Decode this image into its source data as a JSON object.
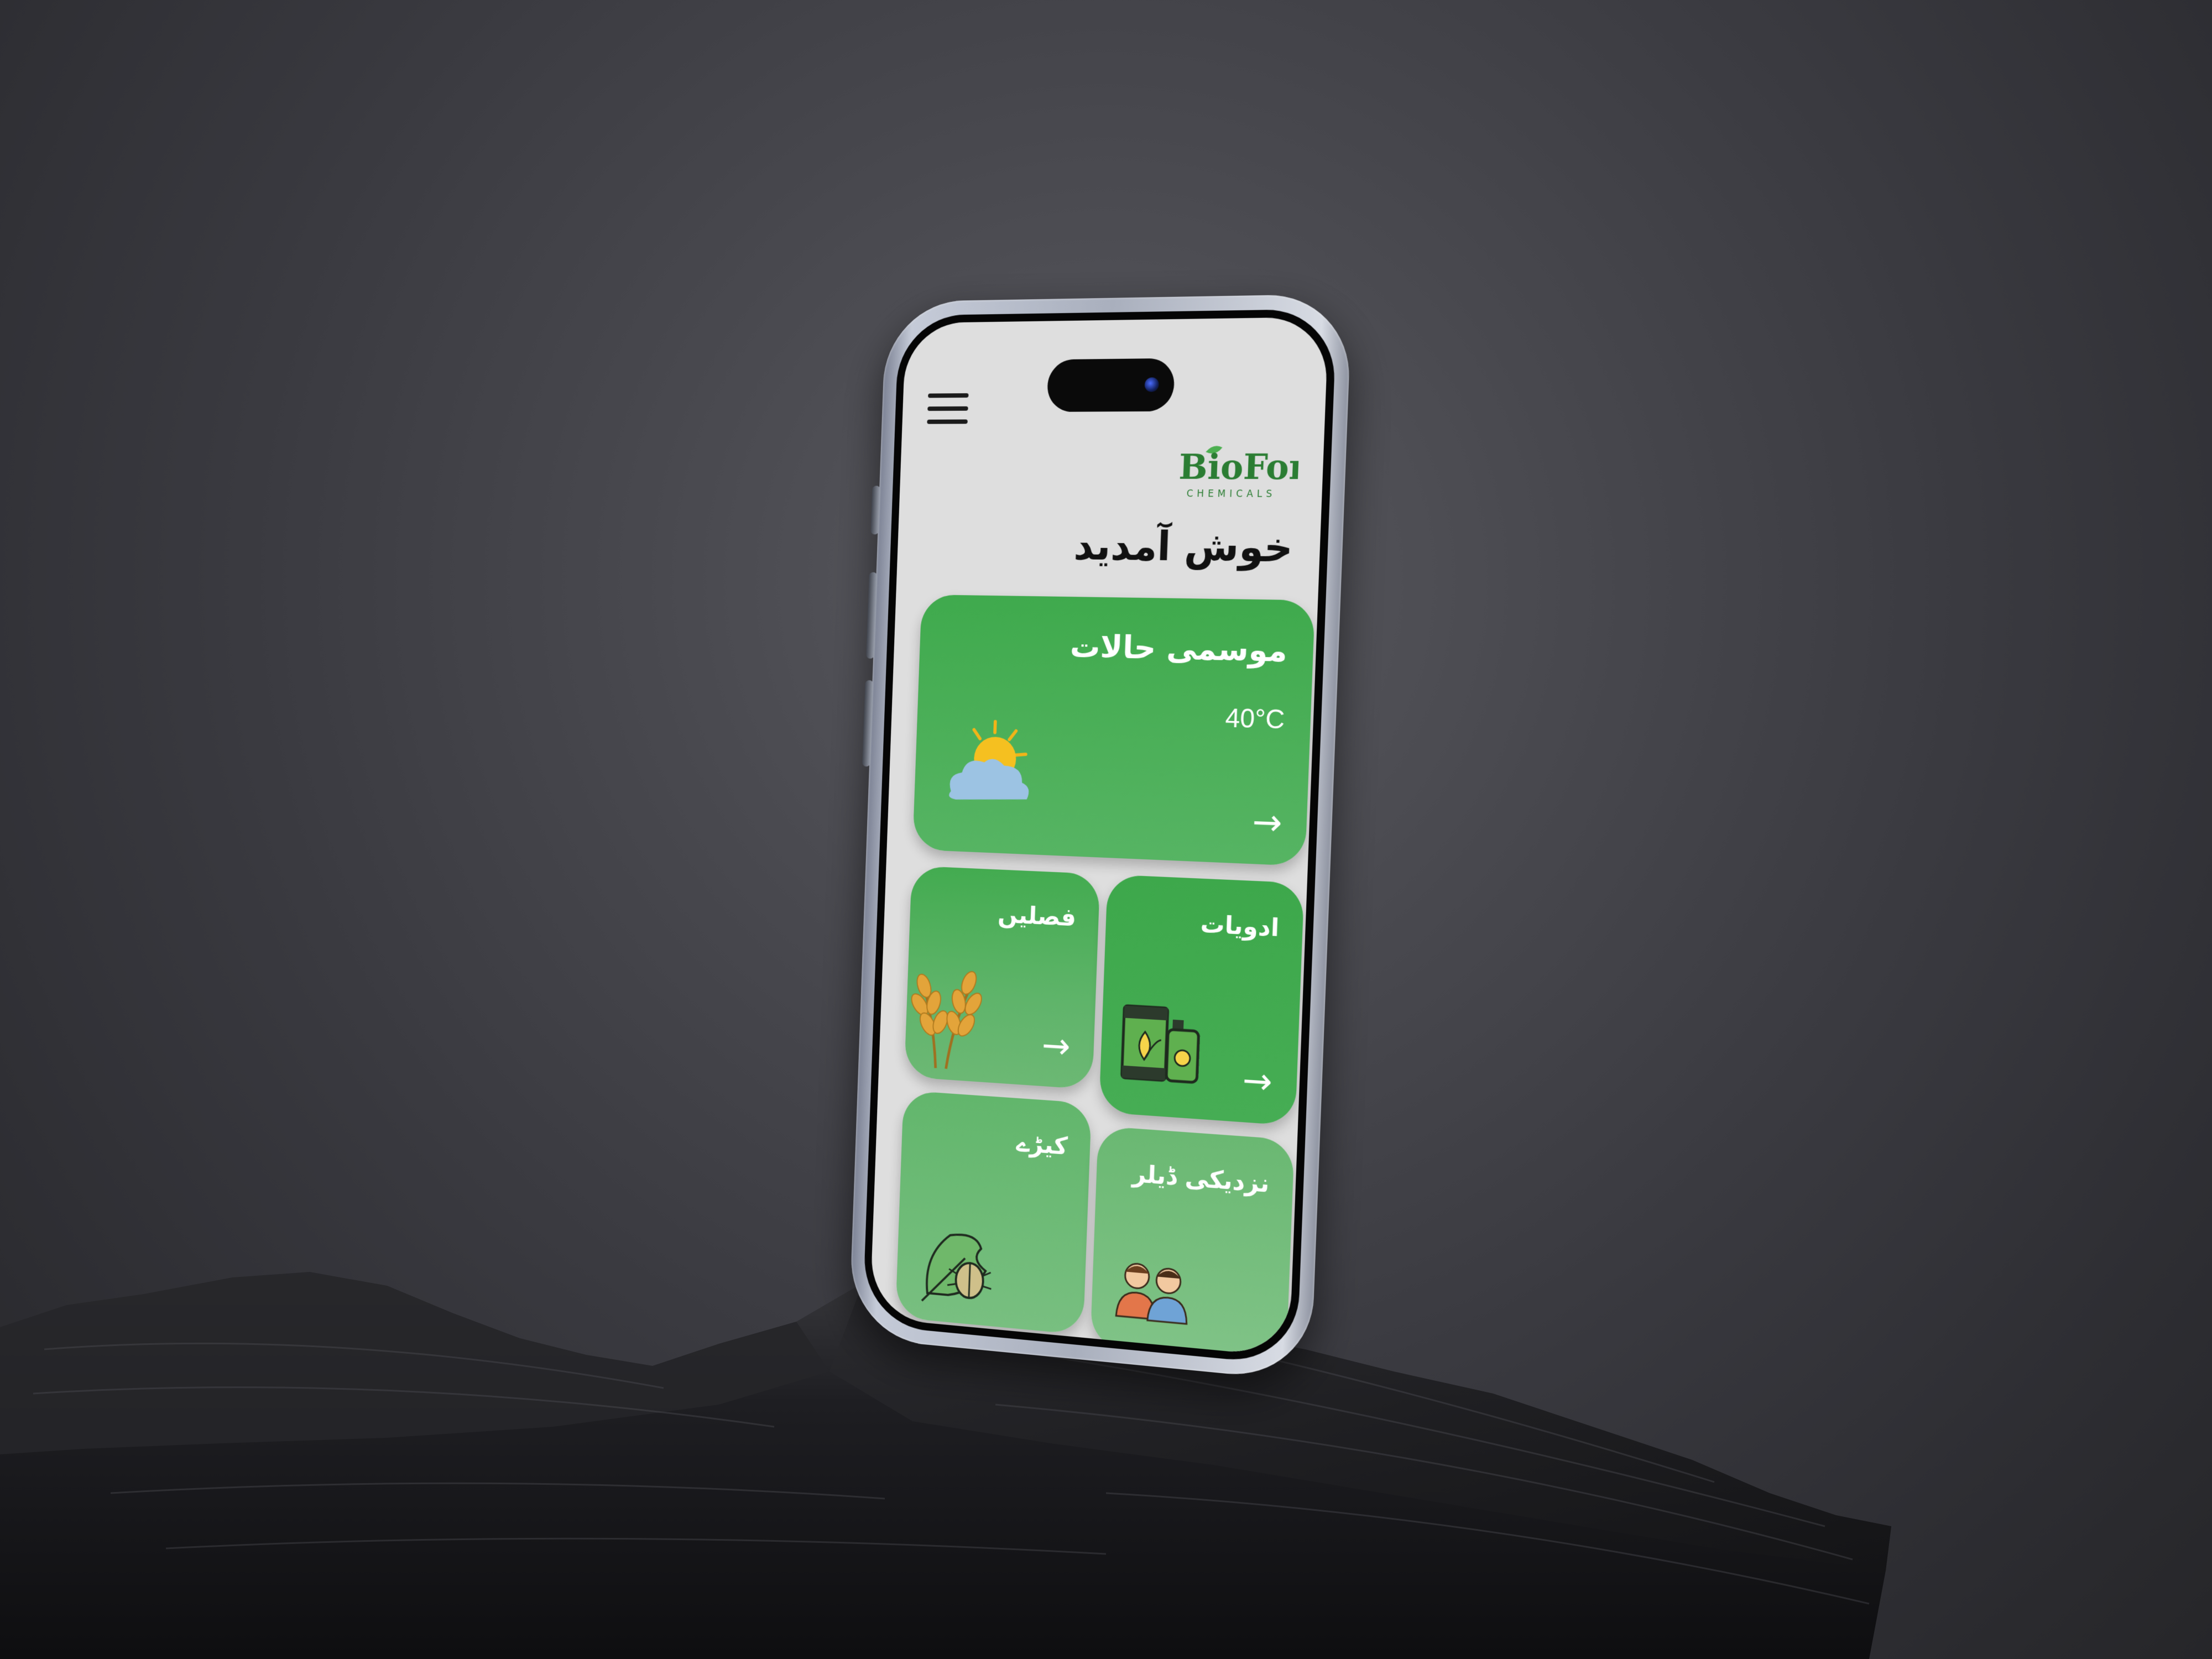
{
  "header": {
    "brand_primary": "BioForce",
    "brand_secondary": "CHEMICALS",
    "welcome": "خوش آمدید"
  },
  "cards": {
    "weather": {
      "title": "موسمی حالات",
      "temperature": "40°C",
      "icon": "partly-cloudy-icon",
      "arrow": "→"
    },
    "crops": {
      "title": "فصلیں",
      "icon": "wheat-icon",
      "arrow": "→"
    },
    "medicines": {
      "title": "ادویات",
      "icon": "pesticide-products-icon",
      "arrow": "→"
    },
    "pests": {
      "title": "کیڑے",
      "icon": "beetle-on-leaf-icon"
    },
    "dealer": {
      "title": "نزدیکی ڈیلر",
      "icon": "dealers-people-icon"
    }
  },
  "colors": {
    "card_green": "#3faa4d",
    "screen_bg": "#dedede",
    "brand_green": "#2e8b3a",
    "text_white": "#ffffff"
  }
}
